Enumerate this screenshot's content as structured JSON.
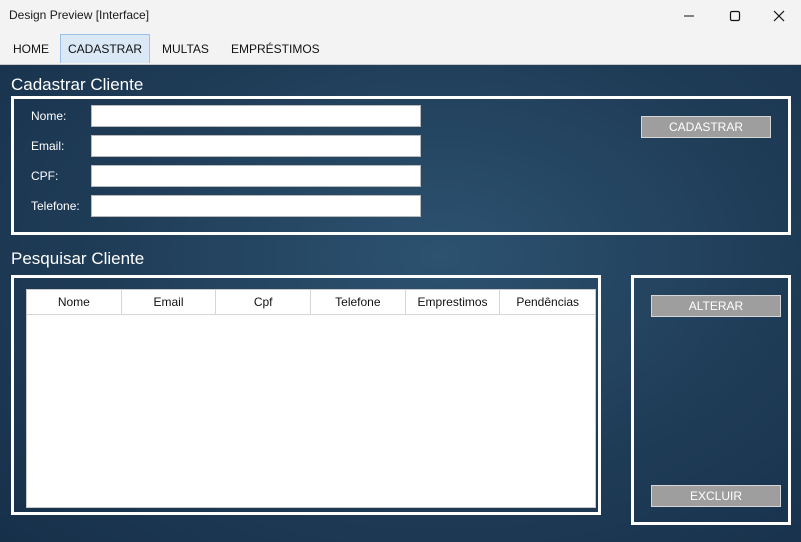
{
  "window": {
    "title": "Design Preview [Interface]",
    "controls": {
      "minimize_icon": "minimize-icon",
      "maximize_icon": "maximize-icon",
      "close_icon": "close-icon"
    }
  },
  "tabs": [
    {
      "label": "HOME",
      "active": false
    },
    {
      "label": "CADASTRAR",
      "active": true
    },
    {
      "label": "MULTAS",
      "active": false
    },
    {
      "label": "EMPRÉSTIMOS",
      "active": false
    }
  ],
  "cadastrar": {
    "title": "Cadastrar Cliente",
    "fields": [
      {
        "label": "Nome:",
        "value": ""
      },
      {
        "label": "Email:",
        "value": ""
      },
      {
        "label": "CPF:",
        "value": ""
      },
      {
        "label": "Telefone:",
        "value": ""
      }
    ],
    "submit_label": "CADASTRAR"
  },
  "pesquisar": {
    "title": "Pesquisar Cliente",
    "columns": [
      "Nome",
      "Email",
      "Cpf",
      "Telefone",
      "Emprestimos",
      "Pendências"
    ],
    "rows": []
  },
  "actions": {
    "alterar_label": "ALTERAR",
    "excluir_label": "EXCLUIR"
  },
  "colors": {
    "background": "#1f3c57",
    "frame": "#ffffff",
    "button": "#9e9e9e",
    "active_tab": "#dbe9f7"
  }
}
